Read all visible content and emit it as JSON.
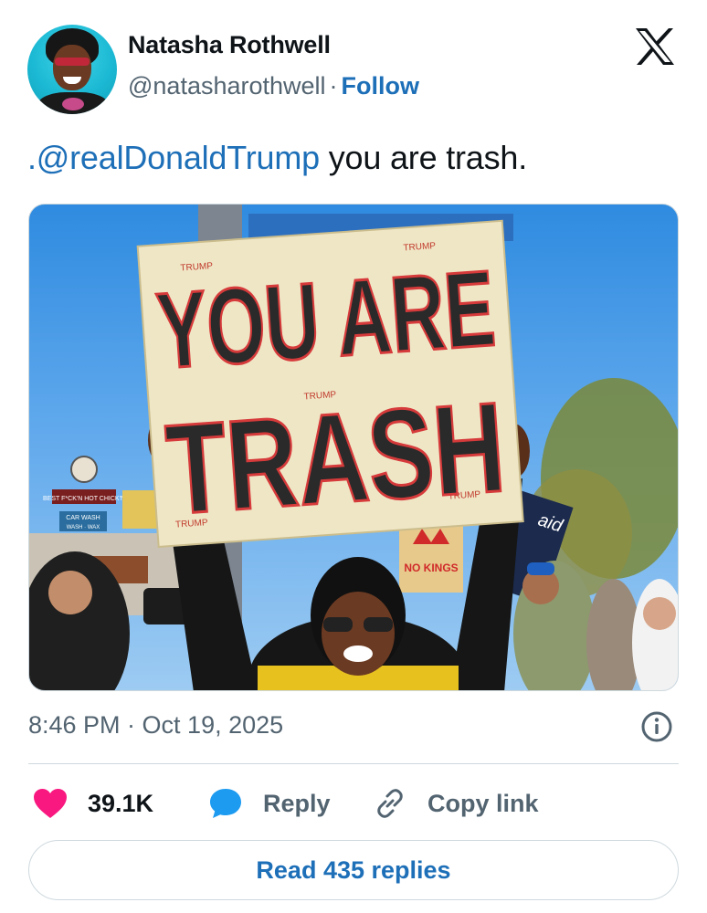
{
  "author": {
    "name": "Natasha Rothwell",
    "handle": "@natasharothwell",
    "separator": "·",
    "follow_label": "Follow"
  },
  "tweet": {
    "mention": ".@realDonaldTrump",
    "text": " you are trash.",
    "timestamp": "8:46 PM · Oct 19, 2025"
  },
  "photo": {
    "sign_line_1": "YOU ARE",
    "sign_line_2": "TRASH",
    "sign_scribble": "TRUMP",
    "store_sign": "BEST F*CK'N HOT CHICK'N",
    "carwash_sign": "CAR WASH",
    "carwash_sub": "WASH · WAX",
    "protest_sign_right": "aid",
    "protest_sign_crown": "NO KINGS"
  },
  "actions": {
    "likes": "39.1K",
    "reply_label": "Reply",
    "copy_label": "Copy link"
  },
  "read_replies_label": "Read 435 replies",
  "colors": {
    "accent": "#1d6fb8",
    "like": "#f91880",
    "reply_icon": "#1d9bf0",
    "muted": "#536471"
  }
}
